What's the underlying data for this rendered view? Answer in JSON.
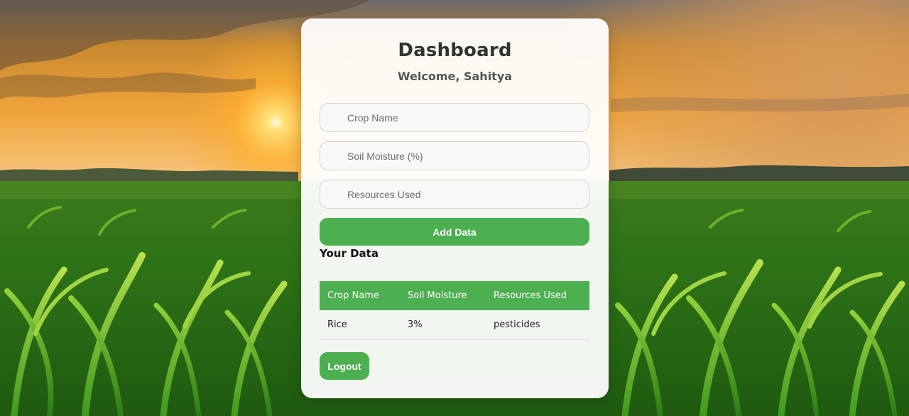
{
  "header": {
    "title": "Dashboard",
    "welcome": "Welcome, Sahitya"
  },
  "form": {
    "crop_placeholder": "Crop Name",
    "moisture_placeholder": "Soil Moisture (%)",
    "resources_placeholder": "Resources Used",
    "add_label": "Add Data"
  },
  "data_section": {
    "title": "Your Data",
    "columns": [
      "Crop Name",
      "Soil Moisture",
      "Resources Used"
    ],
    "rows": [
      [
        "Rice",
        "3%",
        "pesticides"
      ]
    ]
  },
  "actions": {
    "logout_label": "Logout"
  },
  "colors": {
    "accent": "#4caf50",
    "card_bg": "#ffffff",
    "title_text": "#333333"
  }
}
